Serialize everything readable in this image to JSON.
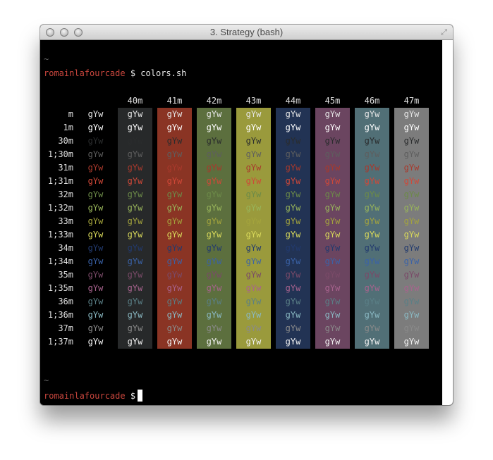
{
  "window": {
    "title": "3. Strategy (bash)"
  },
  "terminal": {
    "tilde1": "~",
    "prompt_user": "romainlafourcade",
    "prompt_symbol": "$",
    "command": "colors.sh",
    "tilde2": "~",
    "prompt_user2": "romainlafourcade",
    "prompt_symbol2": "$"
  },
  "sample_text": "gYw",
  "columns": [
    {
      "label": "40m",
      "bg": "#27292a"
    },
    {
      "label": "41m",
      "bg": "#8a3424"
    },
    {
      "label": "42m",
      "bg": "#5c6f3e"
    },
    {
      "label": "43m",
      "bg": "#9a9a3c"
    },
    {
      "label": "44m",
      "bg": "#223354"
    },
    {
      "label": "45m",
      "bg": "#6b4560"
    },
    {
      "label": "46m",
      "bg": "#516f76"
    },
    {
      "label": "47m",
      "bg": "#7c7c7c"
    }
  ],
  "rows": [
    {
      "label": "m",
      "fg": "#e6e6e6"
    },
    {
      "label": "1m",
      "fg": "#ffffff"
    },
    {
      "label": "30m",
      "fg": "#2a2c2d"
    },
    {
      "label": "1;30m",
      "fg": "#5e5e5e"
    },
    {
      "label": "31m",
      "fg": "#a8392c"
    },
    {
      "label": "1;31m",
      "fg": "#d04838"
    },
    {
      "label": "32m",
      "fg": "#6c8a48"
    },
    {
      "label": "1;32m",
      "fg": "#98b45a"
    },
    {
      "label": "33m",
      "fg": "#a4a43c"
    },
    {
      "label": "1;33m",
      "fg": "#d8d85a"
    },
    {
      "label": "34m",
      "fg": "#223a6e"
    },
    {
      "label": "1;34m",
      "fg": "#3a62a8"
    },
    {
      "label": "35m",
      "fg": "#7a4a68"
    },
    {
      "label": "1;35m",
      "fg": "#a8638e"
    },
    {
      "label": "36m",
      "fg": "#5a7f86"
    },
    {
      "label": "1;36m",
      "fg": "#8ab8c2"
    },
    {
      "label": "37m",
      "fg": "#8a8a8a"
    },
    {
      "label": "1;37m",
      "fg": "#f2f2f2"
    }
  ]
}
